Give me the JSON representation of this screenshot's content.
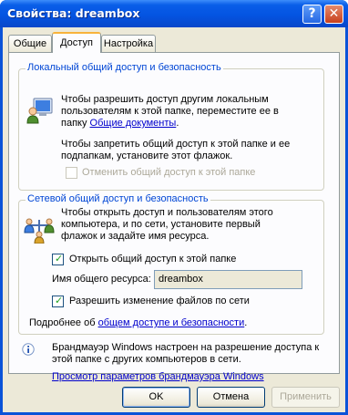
{
  "window": {
    "title": "Свойства: dreambox"
  },
  "tabs": [
    {
      "label": "Общие"
    },
    {
      "label": "Доступ"
    },
    {
      "label": "Настройка"
    }
  ],
  "local": {
    "heading": "Локальный общий доступ и безопасность",
    "text1_l1": "Чтобы разрешить доступ другим локальным",
    "text1_l2": "пользователям к этой папке, переместите ее в",
    "text1_l3_prefix": "папку ",
    "text1_link": "Общие документы",
    "text1_l3_suffix": ".",
    "text2_l1": "Чтобы запретить общий доступ к этой папке и ее",
    "text2_l2": "подпапкам, установите этот флажок.",
    "checkbox_label": "Отменить общий доступ к этой папке"
  },
  "network": {
    "heading": "Сетевой общий доступ и безопасность",
    "text_l1": "Чтобы открыть доступ и пользователям этого",
    "text_l2": "компьютера, и по сети, установите первый",
    "text_l3": "флажок и задайте имя ресурса.",
    "share_checkbox_label": "Открыть общий доступ к этой папке",
    "share_name_label": "Имя общего ресурса:",
    "share_name_value": "dreambox",
    "allow_change_label": "Разрешить изменение файлов по сети",
    "more_prefix": "Подробнее об ",
    "more_link": "общем доступе и безопасности",
    "more_suffix": "."
  },
  "firewall": {
    "text_l1": "Брандмауэр Windows настроен на разрешение доступа к",
    "text_l2": "этой папке с других компьютеров в сети.",
    "link": "Просмотр параметров брандмауэра Windows"
  },
  "buttons": {
    "ok": "OK",
    "cancel": "Отмена",
    "apply": "Применить"
  },
  "colors": {
    "accent_text": "#0046d5",
    "link": "#0000cc",
    "title_bar": "#0454e2"
  }
}
